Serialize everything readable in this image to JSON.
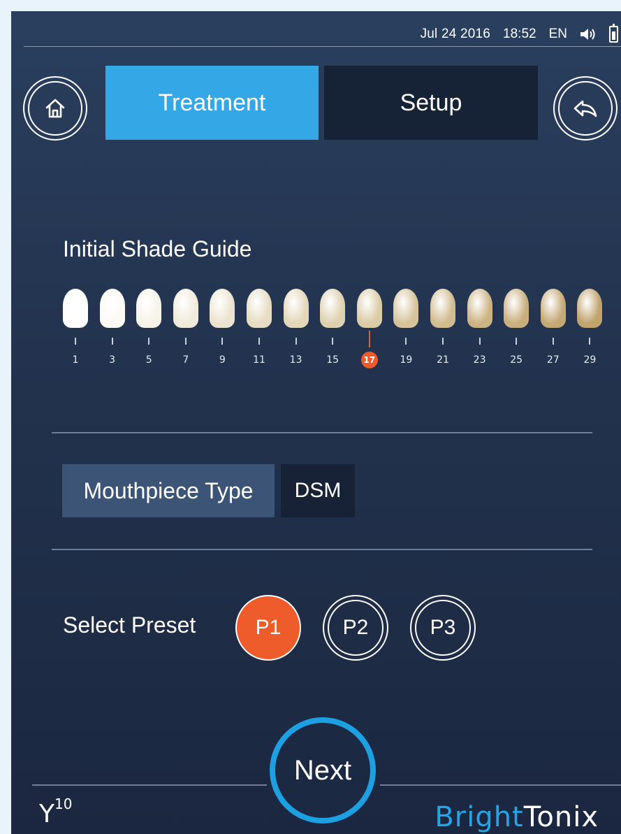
{
  "status_bar": {
    "date": "Jul 24 2016",
    "time": "18:52",
    "language": "EN",
    "icons": [
      "speaker-icon",
      "battery-icon"
    ]
  },
  "nav": {
    "home_icon": "home-icon",
    "back_icon": "back-arrow-icon",
    "tabs": [
      {
        "label": "Treatment",
        "active": true
      },
      {
        "label": "Setup",
        "active": false
      }
    ]
  },
  "shade_guide": {
    "title": "Initial Shade Guide",
    "numbers": [
      "1",
      "3",
      "5",
      "7",
      "9",
      "11",
      "13",
      "15",
      "17",
      "19",
      "21",
      "23",
      "25",
      "27",
      "29"
    ],
    "selected": "17",
    "tooth_colors": [
      "#ffffff",
      "#fbfaf4",
      "#f6f3e9",
      "#f0eadb",
      "#ebe3cf",
      "#e6dcc3",
      "#e3d7b9",
      "#dfd1b0",
      "#dbcca6",
      "#d6c39b",
      "#d1bc90",
      "#ccb484",
      "#c9af7d",
      "#c5a975",
      "#c0a36d"
    ]
  },
  "mouthpiece": {
    "label": "Mouthpiece Type",
    "value": "DSM"
  },
  "presets": {
    "label": "Select Preset",
    "options": [
      {
        "label": "P1",
        "active": true
      },
      {
        "label": "P2",
        "active": false
      },
      {
        "label": "P3",
        "active": false
      }
    ]
  },
  "next_label": "Next",
  "branding": {
    "model_base": "Y",
    "model_sup": "10",
    "brand_part1": "Bright",
    "brand_part2": "Tonix"
  },
  "colors": {
    "accent_blue": "#34a7e6",
    "accent_orange": "#ef5a2d",
    "background": "#22324d"
  }
}
